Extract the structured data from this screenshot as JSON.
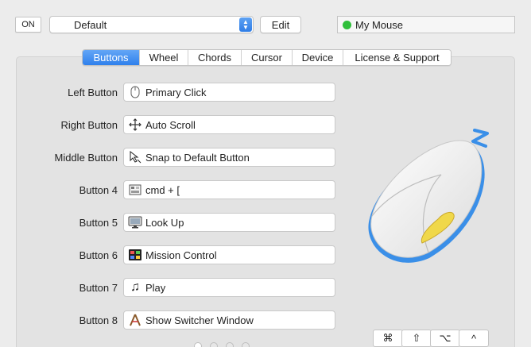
{
  "toolbar": {
    "on_label": "ON",
    "preset": "Default",
    "edit_label": "Edit",
    "device_name": "My Mouse",
    "device_status_color": "#2fbf3a"
  },
  "tabs": [
    {
      "label": "Buttons",
      "active": true
    },
    {
      "label": "Wheel",
      "active": false
    },
    {
      "label": "Chords",
      "active": false
    },
    {
      "label": "Cursor",
      "active": false
    },
    {
      "label": "Device",
      "active": false
    },
    {
      "label": "License & Support",
      "active": false
    }
  ],
  "buttons": [
    {
      "label": "Left Button",
      "icon": "mouse-icon",
      "action": "Primary Click"
    },
    {
      "label": "Right Button",
      "icon": "move-arrows-icon",
      "action": "Auto Scroll"
    },
    {
      "label": "Middle Button",
      "icon": "cursor-snap-icon",
      "action": "Snap to Default Button"
    },
    {
      "label": "Button 4",
      "icon": "keyboard-icon",
      "action": "cmd + ["
    },
    {
      "label": "Button 5",
      "icon": "monitor-icon",
      "action": "Look Up"
    },
    {
      "label": "Button 6",
      "icon": "mission-control-icon",
      "action": "Mission Control"
    },
    {
      "label": "Button 7",
      "icon": "music-note-icon",
      "action": "Play"
    },
    {
      "label": "Button 8",
      "icon": "app-switcher-icon",
      "action": "Show Switcher Window"
    }
  ],
  "modifiers": [
    {
      "label": "⌘",
      "icon": "command-icon"
    },
    {
      "label": "⇧",
      "icon": "shift-icon"
    },
    {
      "label": "⌥",
      "icon": "option-icon"
    },
    {
      "label": "^",
      "icon": "control-icon"
    }
  ],
  "pagination": {
    "pages": 4,
    "current": 1
  },
  "colors": {
    "accent": "#2f80ec",
    "mouse_accent": "#3a8fe8",
    "highlight_button": "#f0d84a"
  }
}
